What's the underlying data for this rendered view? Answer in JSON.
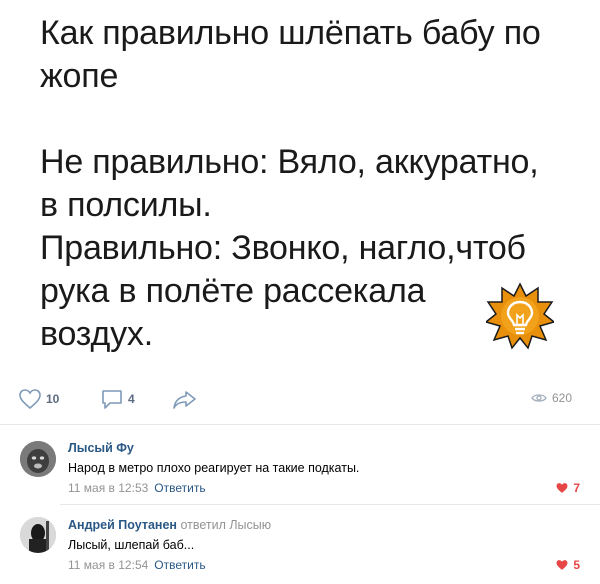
{
  "post": {
    "lines": [
      "Как правильно шлёпать бабу по",
      "жопе",
      "",
      "Не правильно: Вяло, аккуратно,",
      "в полсилы.",
      "Правильно: Звонко, нагло,чтоб",
      "рука в полёте рассекала",
      "воздух."
    ],
    "badge_icon": "lightbulb-icon",
    "badge_color": "#e8900c"
  },
  "actions": {
    "likes": "10",
    "comments": "4",
    "views": "620",
    "icon_color": "#7f9ab8"
  },
  "comments": [
    {
      "author": "Лысый Фу",
      "reply_to": "",
      "text": "Народ в метро плохо реагирует на такие подкаты.",
      "time": "11 мая в 12:53",
      "reply_label": "Ответить",
      "likes": "7"
    },
    {
      "author": "Андрей Поутанен",
      "reply_to": "ответил Лысыю",
      "text": "Лысый, шлепай баб...",
      "time": "11 мая в 12:54",
      "reply_label": "Ответить",
      "likes": "5"
    }
  ],
  "colors": {
    "link": "#2a5885",
    "like_active": "#e64646"
  }
}
